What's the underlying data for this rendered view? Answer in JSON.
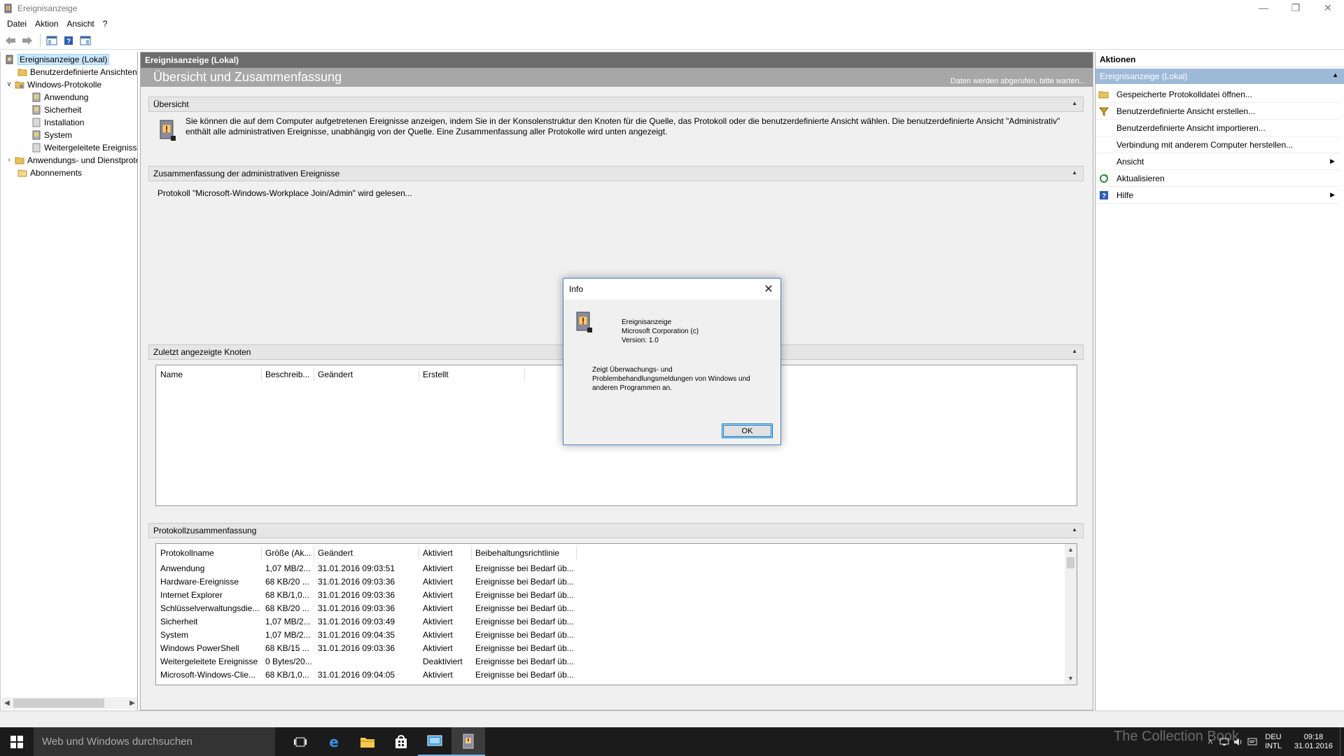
{
  "window": {
    "title": "Ereignisanzeige",
    "controls": [
      "—",
      "❐",
      "✕"
    ]
  },
  "menu": [
    "Datei",
    "Aktion",
    "Ansicht",
    "?"
  ],
  "tree": {
    "items": [
      {
        "label": "Ereignisanzeige (Lokal)",
        "selected": true
      },
      {
        "label": "Benutzerdefinierte Ansichten"
      },
      {
        "label": "Windows-Protokolle",
        "expander": "∨"
      },
      {
        "label": "Anwendung"
      },
      {
        "label": "Sicherheit"
      },
      {
        "label": "Installation"
      },
      {
        "label": "System"
      },
      {
        "label": "Weitergeleitete Ereignisse"
      },
      {
        "label": "Anwendungs- und Dienstprotokolle",
        "expander": "›"
      },
      {
        "label": "Abonnements"
      }
    ]
  },
  "center": {
    "header": "Ereignisanzeige (Lokal)",
    "subheader_title": "Übersicht und Zusammenfassung",
    "subheader_status": "Daten werden abgerufen, bitte warten...",
    "overview": {
      "title": "Übersicht",
      "text": "Sie können die auf dem Computer aufgetretenen Ereignisse anzeigen, indem Sie in der Konsolenstruktur den Knoten für die Quelle, das Protokoll oder die benutzerdefinierte Ansicht wählen. Die benutzerdefinierte Ansicht \"Administrativ\" enthält alle administrativen Ereignisse, unabhängig von der Quelle. Eine Zusammenfassung aller Protokolle wird unten angezeigt."
    },
    "admin_summary": {
      "title": "Zusammenfassung der administrativen Ereignisse",
      "text": "Protokoll \"Microsoft-Windows-Workplace Join/Admin\" wird gelesen..."
    },
    "recent_nodes": {
      "title": "Zuletzt angezeigte Knoten",
      "columns": [
        "Name",
        "Beschreib...",
        "Geändert",
        "Erstellt"
      ]
    },
    "log_summary": {
      "title": "Protokollzusammenfassung",
      "columns": [
        "Protokollname",
        "Größe (Ak...",
        "Geändert",
        "Aktiviert",
        "Beibehaltungsrichtlinie"
      ],
      "rows": [
        [
          "Anwendung",
          "1,07 MB/2...",
          "31.01.2016 09:03:51",
          "Aktiviert",
          "Ereignisse bei Bedarf üb..."
        ],
        [
          "Hardware-Ereignisse",
          "68 KB/20 ...",
          "31.01.2016 09:03:36",
          "Aktiviert",
          "Ereignisse bei Bedarf üb..."
        ],
        [
          "Internet Explorer",
          "68 KB/1,0...",
          "31.01.2016 09:03:36",
          "Aktiviert",
          "Ereignisse bei Bedarf üb..."
        ],
        [
          "Schlüsselverwaltungsdie...",
          "68 KB/20 ...",
          "31.01.2016 09:03:36",
          "Aktiviert",
          "Ereignisse bei Bedarf üb..."
        ],
        [
          "Sicherheit",
          "1,07 MB/2...",
          "31.01.2016 09:03:49",
          "Aktiviert",
          "Ereignisse bei Bedarf üb..."
        ],
        [
          "System",
          "1,07 MB/2...",
          "31.01.2016 09:04:35",
          "Aktiviert",
          "Ereignisse bei Bedarf üb..."
        ],
        [
          "Windows PowerShell",
          "68 KB/15 ...",
          "31.01.2016 09:03:36",
          "Aktiviert",
          "Ereignisse bei Bedarf üb..."
        ],
        [
          "Weitergeleitete Ereignisse",
          "0 Bytes/20...",
          "",
          "Deaktiviert",
          "Ereignisse bei Bedarf üb..."
        ],
        [
          "Microsoft-Windows-Clie...",
          "68 KB/1,0...",
          "31.01.2016 09:04:05",
          "Aktiviert",
          "Ereignisse bei Bedarf üb..."
        ]
      ]
    }
  },
  "actions": {
    "header": "Aktionen",
    "group": "Ereignisanzeige (Lokal)",
    "items": [
      {
        "label": "Gespeicherte Protokolldatei öffnen...",
        "icon": "folder-open-icon"
      },
      {
        "label": "Benutzerdefinierte Ansicht erstellen...",
        "icon": "filter-icon"
      },
      {
        "label": "Benutzerdefinierte Ansicht importieren...",
        "icon": ""
      },
      {
        "label": "Verbindung mit anderem Computer herstellen...",
        "icon": ""
      },
      {
        "label": "Ansicht",
        "icon": "",
        "submenu": true
      },
      {
        "label": "Aktualisieren",
        "icon": "refresh-icon"
      },
      {
        "label": "Hilfe",
        "icon": "help-icon",
        "submenu": true
      }
    ]
  },
  "dialog": {
    "title": "Info",
    "product": "Ereignisanzeige",
    "company": "Microsoft Corporation (c)",
    "version": "Version: 1.0",
    "description": "Zeigt Überwachungs- und Problembehandlungsmeldungen von Windows und anderen Programmen an.",
    "ok_label": "OK"
  },
  "taskbar": {
    "search_placeholder": "Web und Windows durchsuchen",
    "lang_top": "DEU",
    "lang_bottom": "INTL",
    "time": "09:18",
    "date": "31.01.2016",
    "watermark": "The Collection Book"
  },
  "colors": {
    "center_header": "#6d6d6d",
    "subheader": "#a7a7a7",
    "actions_group": "#9db9d8",
    "taskbar": "#1b1b1b",
    "accent": "#0078d7"
  }
}
